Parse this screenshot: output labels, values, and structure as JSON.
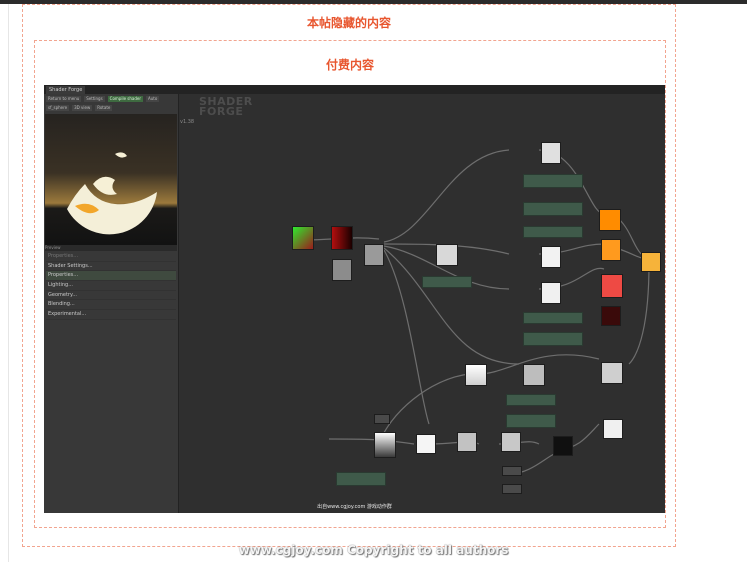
{
  "page": {
    "outer_title": "本帖隐藏的内容",
    "inner_title": "付费内容",
    "footer_watermark": "www.cgjoy.com Copyright to all authors"
  },
  "screenshot": {
    "window_tab": "Shader Forge",
    "toolbar": [
      "Return to menu",
      "Settings",
      "Compile shader",
      "Auto"
    ],
    "preview_controls": [
      "sf_sphere",
      "3D view",
      "Rotate"
    ],
    "preview_label": "Preview",
    "logo_top": "SHADER",
    "logo_bottom": "FORGE",
    "version": "v1.38",
    "menu": [
      "Properties...",
      "Shader Settings...",
      "Properties...",
      "Lighting...",
      "Geometry...",
      "Blending...",
      "Experimental..."
    ],
    "watermark": "出自www.cgjoy.com 游戏动作群"
  },
  "colors": {
    "accent_red": "#e8562f",
    "dashed_border": "#f2a48f",
    "node_orange": "#ff8c00",
    "node_red": "#ee4a44",
    "node_green_bar": "#3f5a4a",
    "wire": "#7a7a7a"
  }
}
